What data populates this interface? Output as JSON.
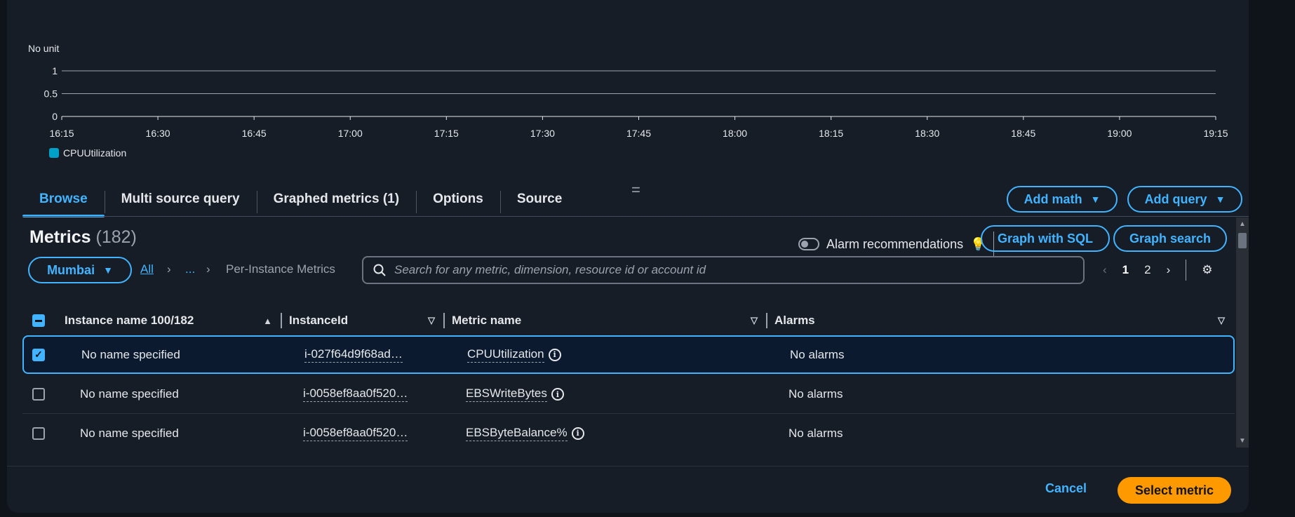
{
  "chart": {
    "unit_label": "No unit",
    "legend_label": "CPUUtilization",
    "series_color": "#00a1c9"
  },
  "chart_data": {
    "type": "line",
    "ylabel": "No unit",
    "yticks": [
      "1",
      "0.5",
      "0"
    ],
    "ylim": [
      0,
      1
    ],
    "x_ticks": [
      "16:15",
      "16:30",
      "16:45",
      "17:00",
      "17:15",
      "17:30",
      "17:45",
      "18:00",
      "18:15",
      "18:30",
      "18:45",
      "19:00",
      "19:15"
    ],
    "series": [
      {
        "name": "CPUUtilization",
        "color": "#00a1c9",
        "values": []
      }
    ],
    "grid": true,
    "legend": "bottom-left"
  },
  "tabs": [
    {
      "label": "Browse",
      "active": true
    },
    {
      "label": "Multi source query",
      "active": false
    },
    {
      "label": "Graphed metrics (1)",
      "active": false
    },
    {
      "label": "Options",
      "active": false
    },
    {
      "label": "Source",
      "active": false
    }
  ],
  "resize_handle": "=",
  "actions": {
    "add_math": "Add math",
    "add_query": "Add query"
  },
  "metrics": {
    "title": "Metrics",
    "count": "(182)",
    "alarm_recommendations": "Alarm recommendations",
    "graph_with_sql": "Graph with SQL",
    "graph_search": "Graph search"
  },
  "filter": {
    "region": "Mumbai",
    "breadcrumb_all": "All",
    "breadcrumb_ellipsis": "...",
    "breadcrumb_current": "Per-Instance Metrics",
    "search_placeholder": "Search for any metric, dimension, resource id or account id"
  },
  "pagination": {
    "current": "1",
    "next": "2"
  },
  "table": {
    "columns": [
      "Instance name 100/182",
      "InstanceId",
      "Metric name",
      "Alarms"
    ],
    "rows": [
      {
        "name": "No name specified",
        "instance_id": "i-027f64d9f68ad…",
        "metric": "CPUUtilization",
        "alarms": "No alarms",
        "checked": true
      },
      {
        "name": "No name specified",
        "instance_id": "i-0058ef8aa0f520…",
        "metric": "EBSWriteBytes",
        "alarms": "No alarms",
        "checked": false
      },
      {
        "name": "No name specified",
        "instance_id": "i-0058ef8aa0f520…",
        "metric": "EBSByteBalance%",
        "alarms": "No alarms",
        "checked": false
      }
    ]
  },
  "footer": {
    "cancel": "Cancel",
    "select_metric": "Select metric"
  },
  "colors": {
    "accent": "#42b4ff",
    "primary_button": "#ff9900",
    "background": "#161d26"
  }
}
